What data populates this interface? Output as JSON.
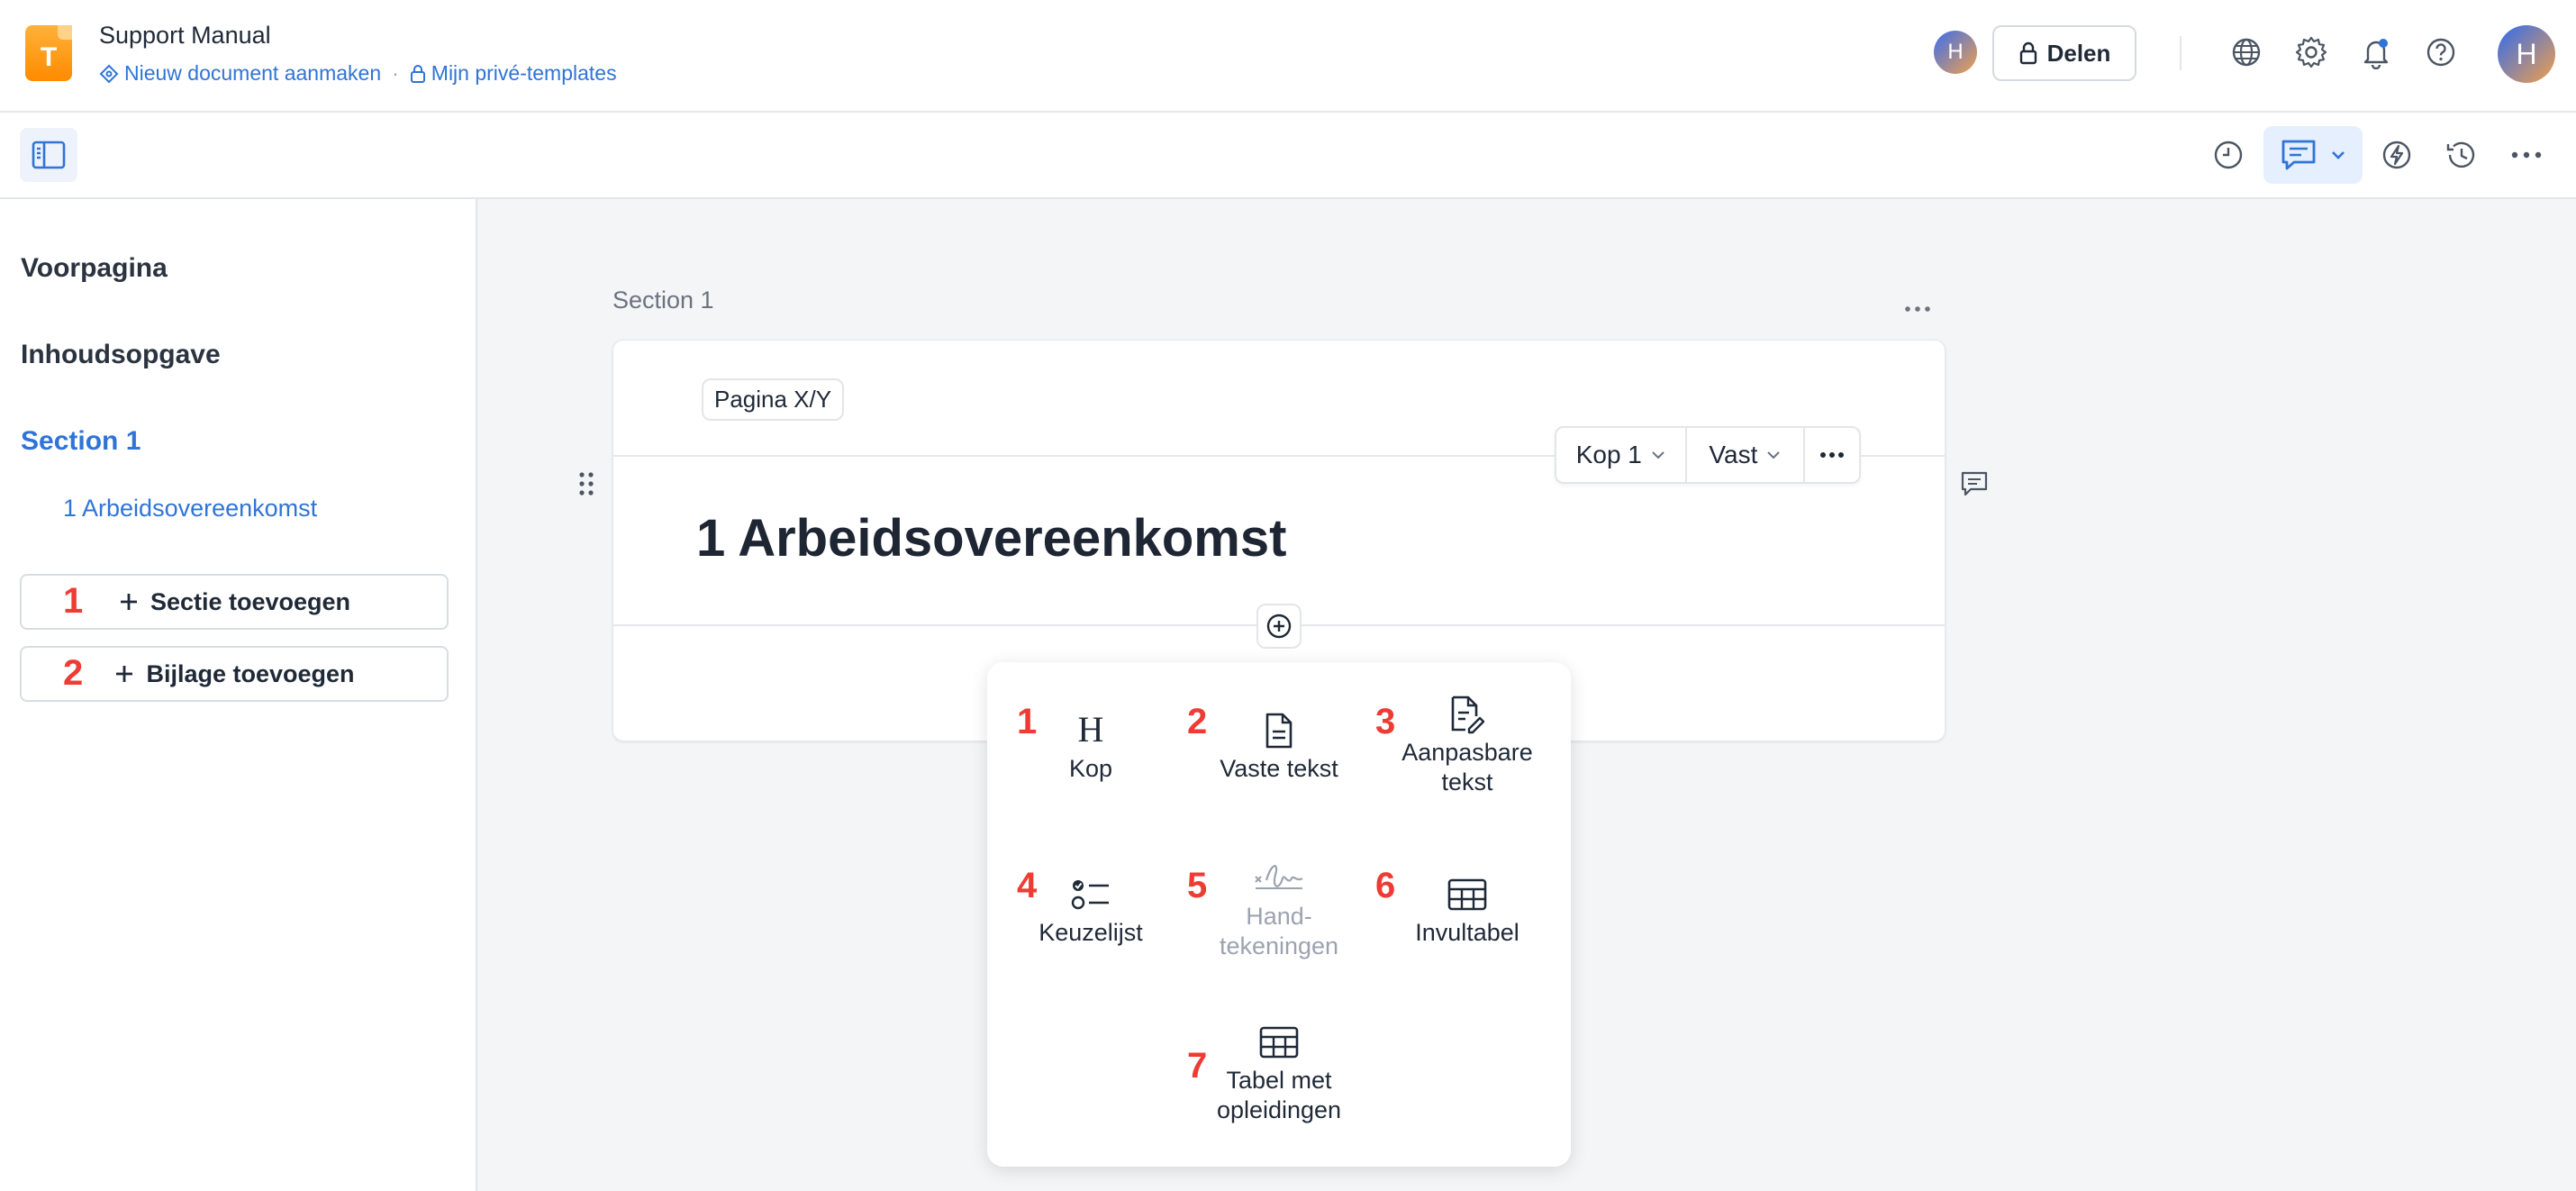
{
  "header": {
    "app_logo_letter": "T",
    "title": "Support Manual",
    "link_new_doc": "Nieuw document aanmaken",
    "separator": "·",
    "link_templates": "Mijn privé-templates",
    "share_label": "Delen",
    "avatar_small_initial": "H",
    "avatar_initial": "H"
  },
  "sidebar": {
    "items": [
      {
        "label": "Voorpagina"
      },
      {
        "label": "Inhoudsopgave"
      },
      {
        "label": "Section 1"
      }
    ],
    "sub_item": "1 Arbeidsovereenkomst",
    "add_section": {
      "badge": "1",
      "label": "Sectie toevoegen"
    },
    "add_appendix": {
      "badge": "2",
      "label": "Bijlage toevoegen"
    }
  },
  "main": {
    "section_label": "Section 1",
    "more_glyph": "···",
    "page_number": "Pagina X/Y",
    "style_bar": {
      "heading_level": "Kop 1",
      "lock": "Vast"
    },
    "heading": "1 Arbeidsovereenkomst"
  },
  "insert_menu": {
    "options": [
      {
        "num": "1",
        "label": "Kop",
        "icon": "heading-icon"
      },
      {
        "num": "2",
        "label": "Vaste tekst",
        "icon": "document-icon"
      },
      {
        "num": "3",
        "label": "Aanpasbare tekst",
        "icon": "document-edit-icon"
      },
      {
        "num": "4",
        "label": "Keuzelijst",
        "icon": "checklist-icon"
      },
      {
        "num": "5",
        "label": "Hand-tekeningen",
        "icon": "signature-icon"
      },
      {
        "num": "6",
        "label": "Invultabel",
        "icon": "table-icon"
      },
      {
        "num": "7",
        "label": "Tabel met opleidingen",
        "icon": "table-icon"
      }
    ]
  },
  "colors": {
    "accent": "#2f74d6",
    "badge": "#ee3b34",
    "logo": "#ff9a1a"
  }
}
